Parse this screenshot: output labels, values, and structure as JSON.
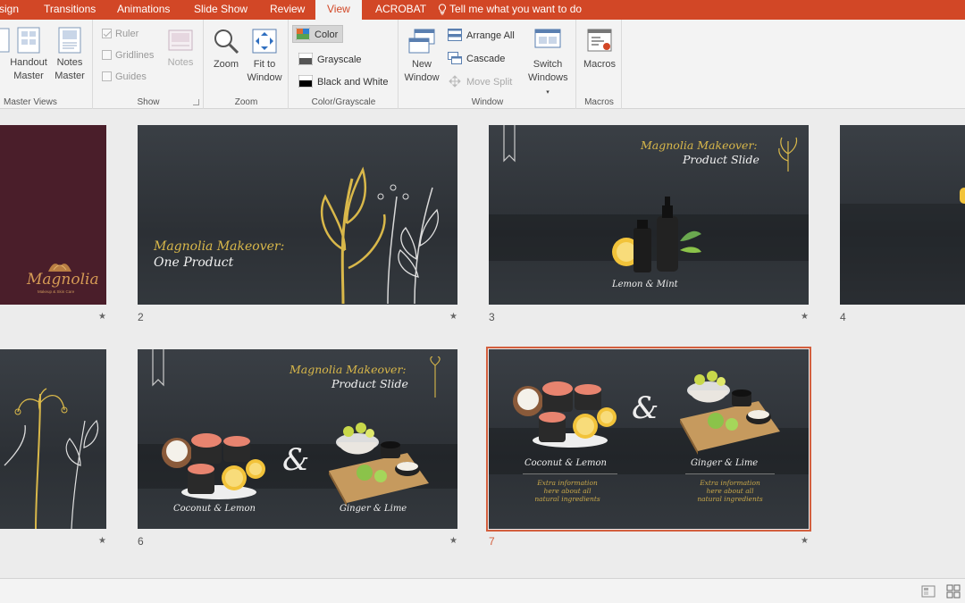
{
  "tabs": [
    {
      "label": "sign"
    },
    {
      "label": "Transitions"
    },
    {
      "label": "Animations"
    },
    {
      "label": "Slide Show"
    },
    {
      "label": "Review"
    },
    {
      "label": "View"
    },
    {
      "label": "ACROBAT"
    }
  ],
  "tell_me": "Tell me what you want to do",
  "colors": {
    "accent": "#d24726",
    "selection": "#d35f3e",
    "title_gold": "#d9b84a"
  },
  "ribbon": {
    "master_views": {
      "label": "Master Views",
      "handout_master": "Handout Master",
      "notes_master": "Notes Master"
    },
    "show": {
      "label": "Show",
      "ruler": "Ruler",
      "ruler_checked": true,
      "gridlines": "Gridlines",
      "gridlines_checked": false,
      "guides": "Guides",
      "guides_checked": false,
      "notes": "Notes"
    },
    "zoom": {
      "label": "Zoom",
      "zoom_btn": "Zoom",
      "fit_to_window": "Fit to Window"
    },
    "color_grayscale": {
      "label": "Color/Grayscale",
      "color": "Color",
      "grayscale": "Grayscale",
      "black_and_white": "Black and White"
    },
    "window": {
      "label": "Window",
      "new_window": "New Window",
      "arrange_all": "Arrange All",
      "cascade": "Cascade",
      "move_split": "Move Split",
      "switch_windows": "Switch Windows"
    },
    "macros": {
      "label": "Macros",
      "macros_btn": "Macros"
    }
  },
  "slides": [
    {
      "number": "",
      "logo": "Magnolia",
      "logo_sub": "Makeup & Skin Care"
    },
    {
      "number": "2",
      "title": "Magnolia Makeover:",
      "subtitle": "One Product"
    },
    {
      "number": "3",
      "title": "Magnolia Makeover:",
      "subtitle": "Product Slide",
      "caption": "Lemon & Mint"
    },
    {
      "number": "4"
    },
    {
      "number": ""
    },
    {
      "number": "6",
      "title": "Magnolia Makeover:",
      "subtitle": "Product Slide",
      "caption_left": "Coconut & Lemon",
      "ampersand": "&",
      "caption_right": "Ginger & Lime"
    },
    {
      "number": "7",
      "caption_left": "Coconut & Lemon",
      "ampersand": "&",
      "caption_right": "Ginger & Lime",
      "note_left": "Extra information here about all natural ingredients",
      "note_right": "Extra information here about all natural ingredients",
      "selected": true
    }
  ]
}
